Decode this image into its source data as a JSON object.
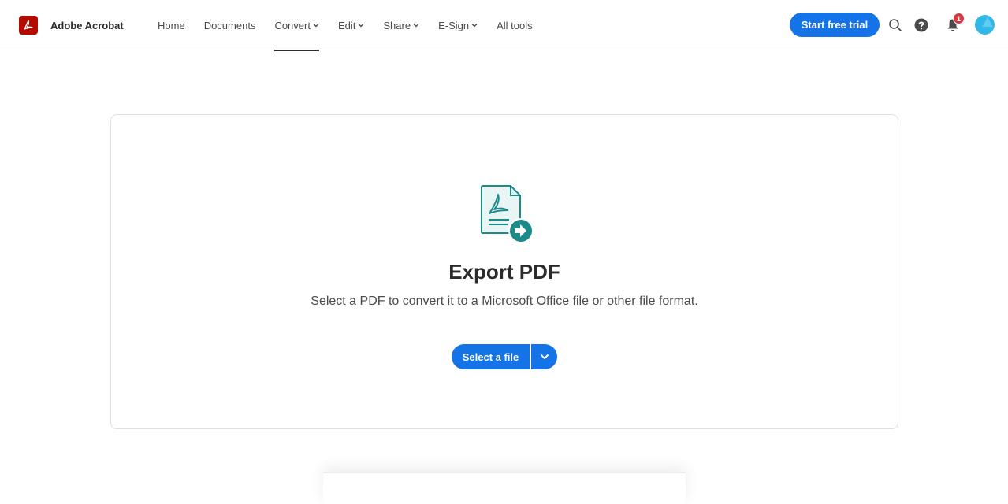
{
  "header": {
    "brand_name": "Adobe Acrobat",
    "nav": [
      {
        "label": "Home",
        "has_dropdown": false,
        "active": false
      },
      {
        "label": "Documents",
        "has_dropdown": false,
        "active": false
      },
      {
        "label": "Convert",
        "has_dropdown": true,
        "active": true
      },
      {
        "label": "Edit",
        "has_dropdown": true,
        "active": false
      },
      {
        "label": "Share",
        "has_dropdown": true,
        "active": false
      },
      {
        "label": "E-Sign",
        "has_dropdown": true,
        "active": false
      },
      {
        "label": "All tools",
        "has_dropdown": false,
        "active": false
      }
    ],
    "trial_button": "Start free trial",
    "notification_count": "1"
  },
  "main": {
    "title": "Export PDF",
    "subtitle": "Select a PDF to convert it to a Microsoft Office file or other file format.",
    "select_button": "Select a file"
  },
  "colors": {
    "brand_red": "#b30b00",
    "accent_blue": "#1473e6",
    "icon_teal": "#1d8a8a",
    "badge_red": "#d7373f"
  }
}
